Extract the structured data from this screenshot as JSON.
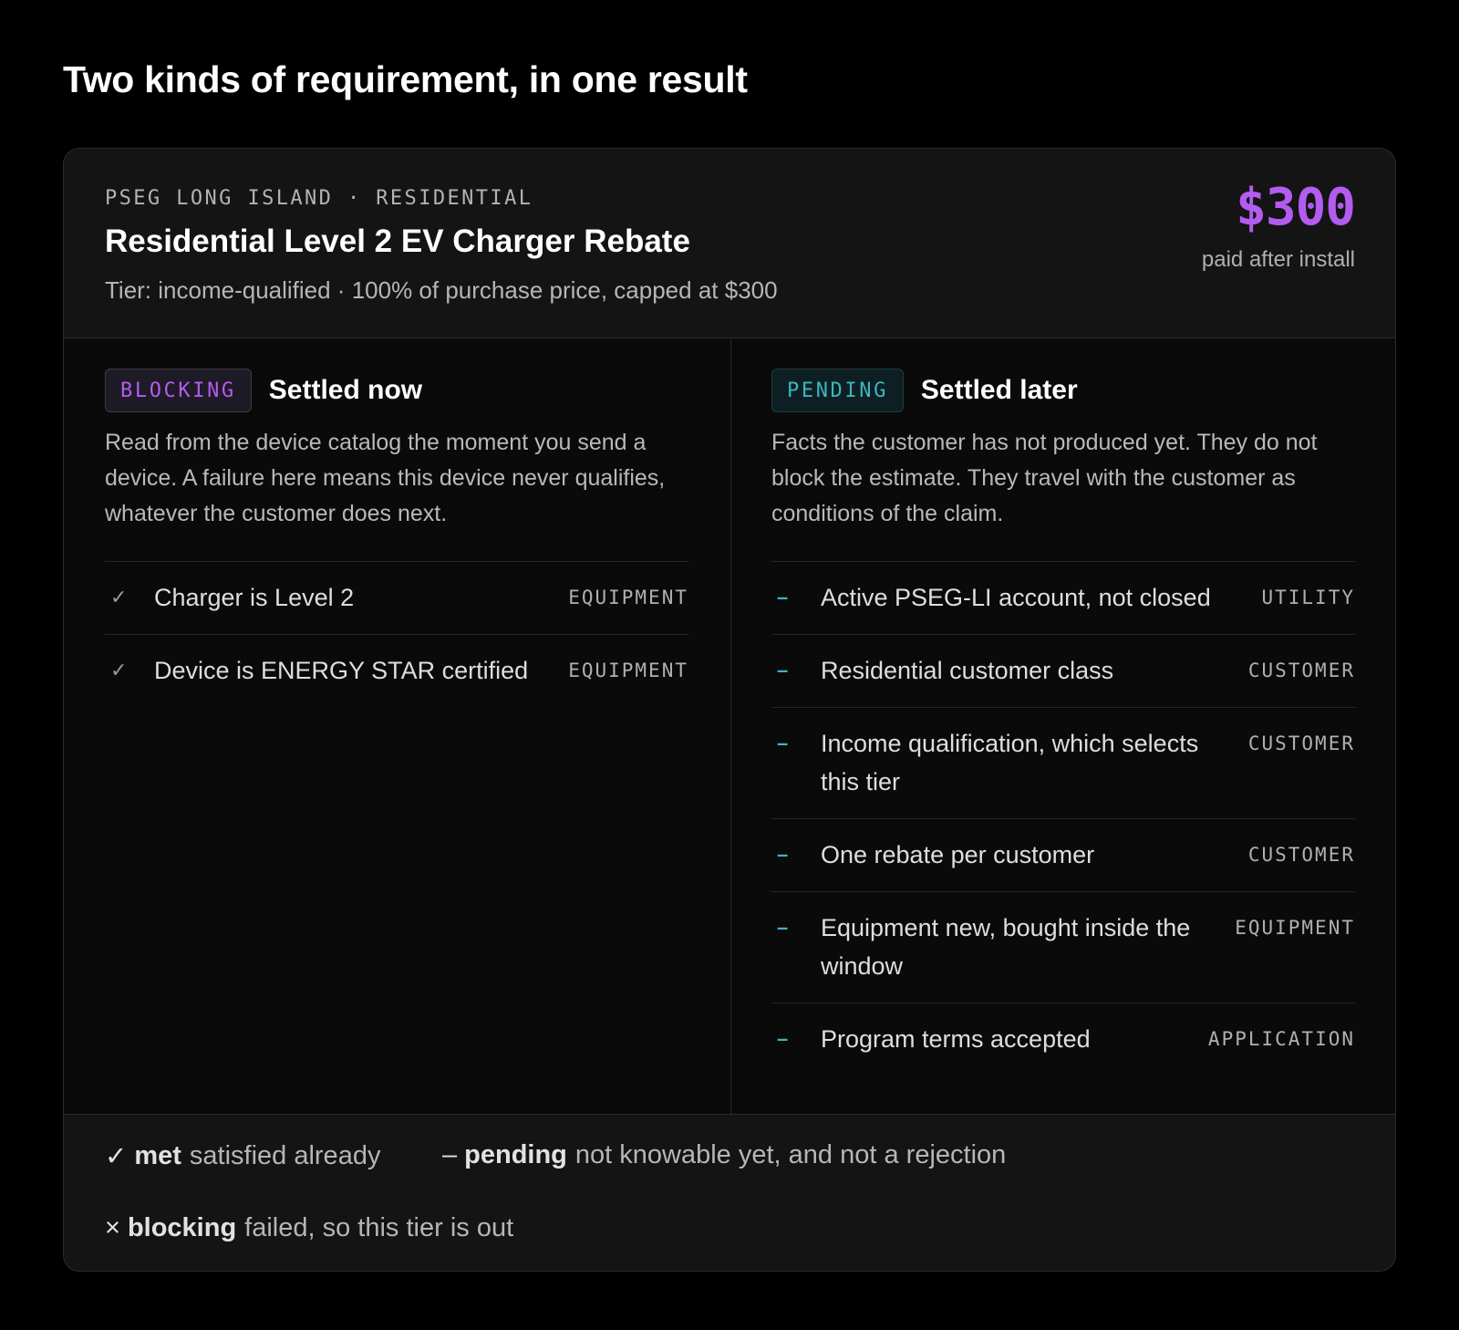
{
  "page": {
    "title": "Two kinds of requirement, in one result"
  },
  "header": {
    "eyebrow": "PSEG LONG ISLAND · RESIDENTIAL",
    "title": "Residential Level 2 EV Charger Rebate",
    "tier_line": "Tier: income-qualified · 100% of purchase price, capped at $300",
    "amount": "$300",
    "amount_note": "paid after install"
  },
  "blocking": {
    "badge": "BLOCKING",
    "heading": "Settled now",
    "description": "Read from the device catalog the moment you send a device. A failure here means this device never qualifies, whatever the customer does next.",
    "items": [
      {
        "mark": "✓",
        "text": "Charger is Level 2",
        "category": "EQUIPMENT"
      },
      {
        "mark": "✓",
        "text": "Device is ENERGY STAR certified",
        "category": "EQUIPMENT"
      }
    ]
  },
  "pending": {
    "badge": "PENDING",
    "heading": "Settled later",
    "description": "Facts the customer has not produced yet. They do not block the estimate. They travel with the customer as conditions of the claim.",
    "items": [
      {
        "mark": "–",
        "text": "Active PSEG-LI account, not closed",
        "category": "UTILITY"
      },
      {
        "mark": "–",
        "text": "Residential customer class",
        "category": "CUSTOMER"
      },
      {
        "mark": "–",
        "text": "Income qualification, which selects this tier",
        "category": "CUSTOMER"
      },
      {
        "mark": "–",
        "text": "One rebate per customer",
        "category": "CUSTOMER"
      },
      {
        "mark": "–",
        "text": "Equipment new, bought inside the window",
        "category": "EQUIPMENT"
      },
      {
        "mark": "–",
        "text": "Program terms accepted",
        "category": "APPLICATION"
      }
    ]
  },
  "legend": {
    "met": {
      "symbol": "✓",
      "term": "met",
      "desc": "satisfied already"
    },
    "pending": {
      "symbol": "–",
      "term": "pending",
      "desc": "not knowable yet, and not a rejection"
    },
    "blocking": {
      "symbol": "×",
      "term": "blocking",
      "desc": "failed, so this tier is out"
    }
  },
  "colors": {
    "accent_purple": "#b25cf0",
    "accent_teal": "#3fb4bf",
    "background": "#000000",
    "card": "#0a0a0a"
  }
}
